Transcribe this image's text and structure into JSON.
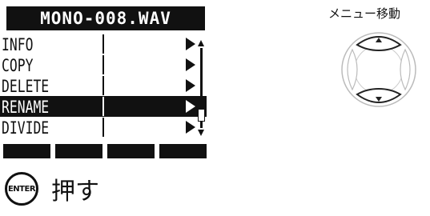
{
  "screen": {
    "title": "MONO-008.WAV",
    "menu_items": [
      {
        "label": "INFO",
        "selected": false
      },
      {
        "label": "COPY",
        "selected": false
      },
      {
        "label": "DELETE",
        "selected": false
      },
      {
        "label": "RENAME",
        "selected": true
      },
      {
        "label": "DIVIDE",
        "selected": false
      }
    ]
  },
  "enter": {
    "button_label": "ENTER",
    "instruction": "押す"
  },
  "dpad": {
    "label": "メニュー移動"
  }
}
